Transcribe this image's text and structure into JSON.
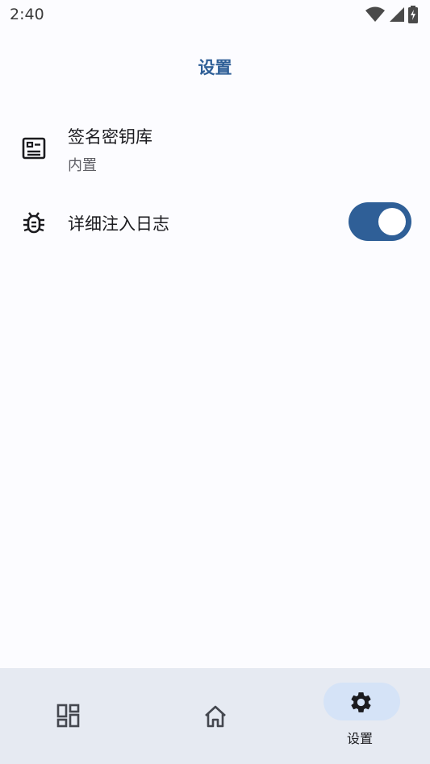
{
  "status_bar": {
    "time": "2:40",
    "icons": [
      "wifi-icon",
      "cellular-signal-icon",
      "battery-charging-icon"
    ]
  },
  "header": {
    "title": "设置"
  },
  "settings": [
    {
      "title": "签名密钥库",
      "subtitle": "内置",
      "icon": "keystore-card-icon"
    },
    {
      "title": "详细注入日志",
      "icon": "bug-icon",
      "toggle_on": true
    }
  ],
  "bottom_nav": {
    "items": [
      {
        "icon": "dashboard-icon",
        "label": ""
      },
      {
        "icon": "home-icon",
        "label": ""
      },
      {
        "icon": "settings-gear-icon",
        "label": "设置",
        "selected": true
      }
    ]
  },
  "colors": {
    "accent": "#2f5f97",
    "background": "#fcfcff",
    "nav_background": "#e6eaf2",
    "nav_indicator": "#d5e3f7"
  }
}
